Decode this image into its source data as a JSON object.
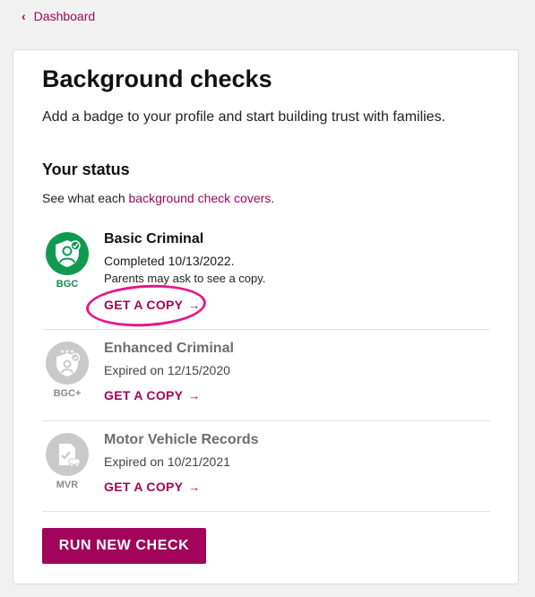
{
  "nav": {
    "back_label": "Dashboard"
  },
  "page": {
    "title": "Background checks",
    "subtitle": "Add a badge to your profile and start building trust with families."
  },
  "status": {
    "heading": "Your status",
    "note_prefix": "See what each ",
    "note_link": "background check covers",
    "note_suffix": "."
  },
  "checks": [
    {
      "name": "Basic Criminal",
      "badge_code": "BGC",
      "state": "Completed 10/13/2022.",
      "note": "Parents may ask to see a copy.",
      "action": "GET A COPY",
      "action_arrow": "→",
      "badge_color": "#109a4f"
    },
    {
      "name": "Enhanced Criminal",
      "badge_code": "BGC+",
      "state": "Expired on 12/15/2020",
      "action": "GET A COPY",
      "action_arrow": "→",
      "badge_color": "#c9c9c9"
    },
    {
      "name": "Motor Vehicle Records",
      "badge_code": "MVR",
      "state": "Expired on 10/21/2021",
      "action": "GET A COPY",
      "action_arrow": "→",
      "badge_color": "#c9c9c9"
    }
  ],
  "actions": {
    "run_new_check": "RUN NEW CHECK"
  },
  "colors": {
    "accent": "#a1045a",
    "highlight": "#e6178a",
    "success": "#109a4f"
  }
}
